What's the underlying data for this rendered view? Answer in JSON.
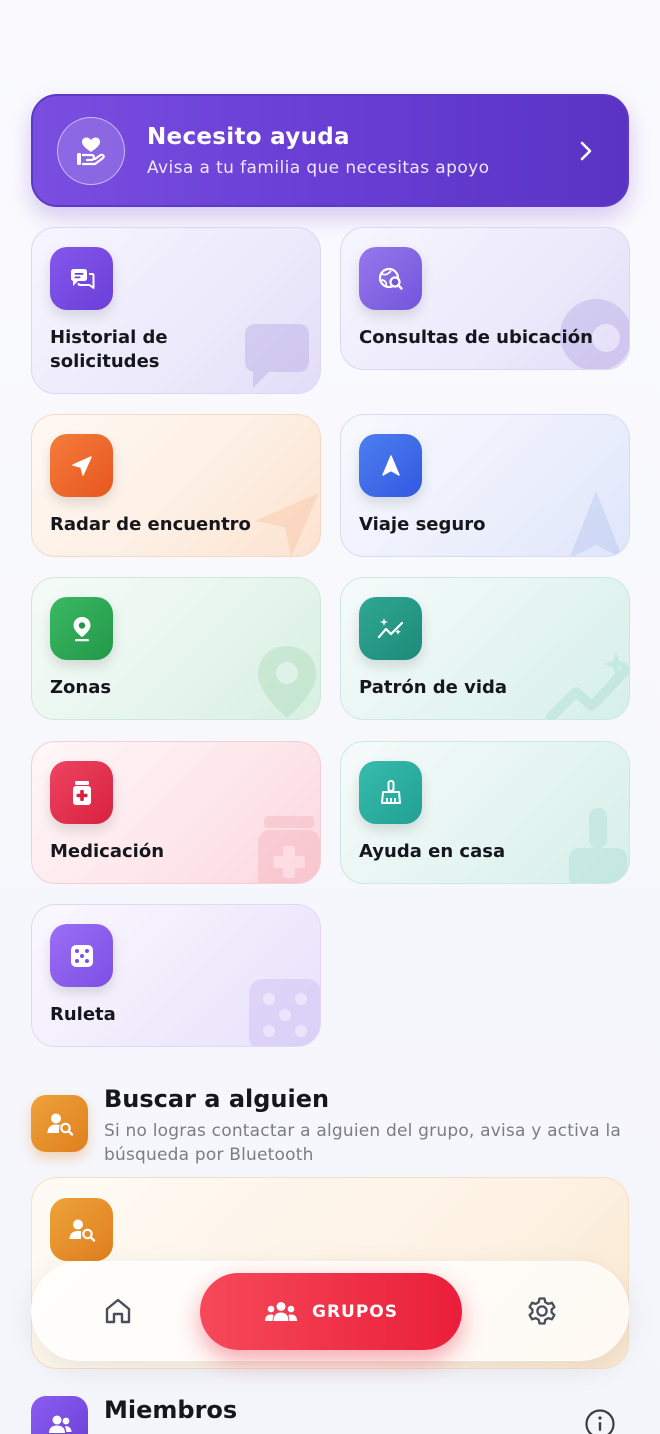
{
  "help_banner": {
    "title": "Necesito ayuda",
    "subtitle": "Avisa a tu familia que necesitas apoyo",
    "icon": "hand-heart-icon",
    "accent": "#6a3fd6"
  },
  "tiles": [
    {
      "label": "Historial de solicitudes",
      "icon": "chat-icon",
      "color": "#6f45dc"
    },
    {
      "label": "Consultas de ubicación",
      "icon": "globe-search-icon",
      "color": "#7b5fe0"
    },
    {
      "label": "Radar de encuentro",
      "icon": "navigation-arrow-icon",
      "color": "#ef6a2a"
    },
    {
      "label": "Viaje seguro",
      "icon": "navigation-up-icon",
      "color": "#3e6ce8"
    },
    {
      "label": "Zonas",
      "icon": "map-pin-icon",
      "color": "#2fa84e"
    },
    {
      "label": "Patrón de vida",
      "icon": "trend-sparkle-icon",
      "color": "#239a86"
    },
    {
      "label": "Medicación",
      "icon": "medicine-icon",
      "color": "#e52d4d"
    },
    {
      "label": "Ayuda en casa",
      "icon": "broom-icon",
      "color": "#2bb0a5"
    },
    {
      "label": "Ruleta",
      "icon": "dice-icon",
      "color": "#8b5cf0"
    }
  ],
  "search_section": {
    "title": "Buscar a alguien",
    "description": "Si no logras contactar a alguien del grupo, avisa y activa la búsqueda por Bluetooth",
    "icon": "person-search-icon"
  },
  "bottom_nav": {
    "home_icon": "home-icon",
    "groups_label": "GRUPOS",
    "groups_icon": "group-icon",
    "settings_icon": "gear-icon",
    "active_color": "#ea1e3a"
  },
  "members_section": {
    "title": "Miembros",
    "icon": "group-icon",
    "info_icon": "info-icon"
  }
}
